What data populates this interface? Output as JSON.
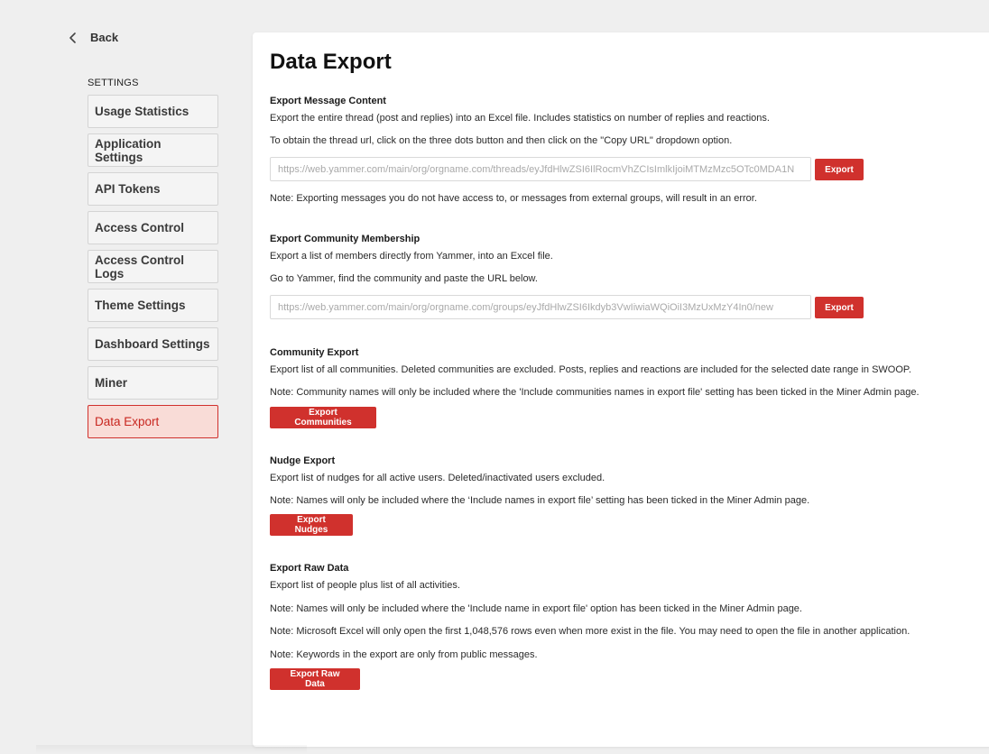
{
  "back": {
    "label": "Back"
  },
  "sidebar": {
    "heading": "SETTINGS",
    "items": [
      {
        "label": "Usage Statistics"
      },
      {
        "label": "Application Settings"
      },
      {
        "label": "API Tokens"
      },
      {
        "label": "Access Control"
      },
      {
        "label": "Access Control Logs"
      },
      {
        "label": "Theme Settings"
      },
      {
        "label": "Dashboard Settings"
      },
      {
        "label": "Miner"
      },
      {
        "label": "Data Export",
        "active": true
      }
    ]
  },
  "main": {
    "title": "Data Export",
    "message_content": {
      "title": "Export Message Content",
      "description": "Export the entire thread (post and replies) into an Excel file. Includes statistics on number of replies and reactions.",
      "instruction": "To obtain the thread url, click on the three dots button and then click on the \"Copy URL\" dropdown option.",
      "input_value": "",
      "input_placeholder": "https://web.yammer.com/main/org/orgname.com/threads/eyJfdHlwZSI6IlRocmVhZCIsImlkIjoiMTMzMzc5OTc0MDA1N",
      "button_label": "Export",
      "note": "Note: Exporting messages you do not have access to, or messages from external groups, will result in an error."
    },
    "community_membership": {
      "title": "Export Community Membership",
      "description": "Export a list of members directly from Yammer, into an Excel file.",
      "instruction": "Go to Yammer, find the community and paste the URL below.",
      "input_value": "",
      "input_placeholder": "https://web.yammer.com/main/org/orgname.com/groups/eyJfdHlwZSI6Ikdyb3VwIiwiaWQiOiI3MzUxMzY4In0/new",
      "button_label": "Export"
    },
    "community_export": {
      "title": "Community Export",
      "description": "Export list of all communities. Deleted communities are excluded. Posts, replies and reactions are included for the selected date range in SWOOP.",
      "note": "Note: Community names will only be included where the 'Include communities names in export file' setting has been ticked in the Miner Admin page.",
      "button_label": "Export Communities"
    },
    "nudge_export": {
      "title": "Nudge Export",
      "description": "Export list of nudges for all active users. Deleted/inactivated users excluded.",
      "note": "Note: Names will only be included where the ‘Include names in export file’ setting has been ticked in the Miner Admin page.",
      "button_label": "Export Nudges"
    },
    "raw_data": {
      "title": "Export Raw Data",
      "description": "Export list of people plus list of all activities.",
      "note1": "Note: Names will only be included where the 'Include name in export file' option has been ticked in the Miner Admin page.",
      "note2": "Note: Microsoft Excel will only open the first 1,048,576 rows even when more exist in the file. You may need to open the file in another application.",
      "note3": "Note: Keywords in the export are only from public messages.",
      "button_label": "Export Raw Data"
    }
  },
  "colors": {
    "accent": "#d0312d",
    "active_bg": "#f9dcd7",
    "page_bg": "#efefef"
  },
  "icons": {
    "back": "chevron-left-icon"
  }
}
